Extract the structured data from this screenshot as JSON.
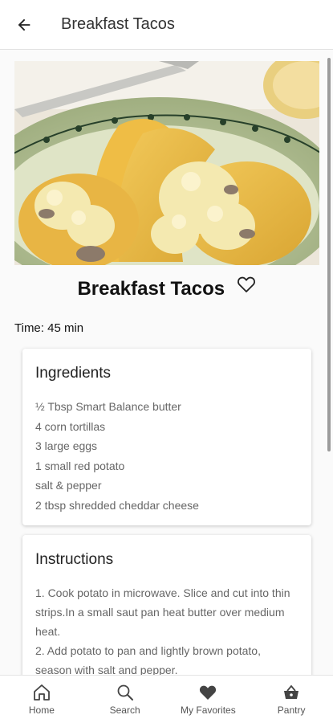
{
  "appbar": {
    "title": "Breakfast Tacos",
    "back_icon": "arrow-back-icon"
  },
  "recipe": {
    "title": "Breakfast Tacos",
    "time": "Time: 45 min",
    "favorite_icon": "heart-outline-icon"
  },
  "ingredients": {
    "title": "Ingredients",
    "items": [
      "½ Tbsp Smart Balance butter",
      "4 corn tortillas",
      "3 large eggs",
      "1 small red potato",
      "salt & pepper",
      "2 tbsp shredded cheddar cheese"
    ]
  },
  "instructions": {
    "title": "Instructions",
    "text": "1. Cook potato in microwave. Slice and cut into thin strips.In a small saut pan heat butter over medium heat.\n2. Add potato to pan and lightly brown potato, season with salt and pepper."
  },
  "bottom_nav": [
    {
      "label": "Home",
      "icon": "home-icon"
    },
    {
      "label": "Search",
      "icon": "search-icon"
    },
    {
      "label": "My Favorites",
      "icon": "heart-filled-icon"
    },
    {
      "label": "Pantry",
      "icon": "basket-icon"
    }
  ],
  "colors": {
    "accent": "#444444",
    "card_bg": "#ffffff",
    "text_muted": "#666666"
  }
}
